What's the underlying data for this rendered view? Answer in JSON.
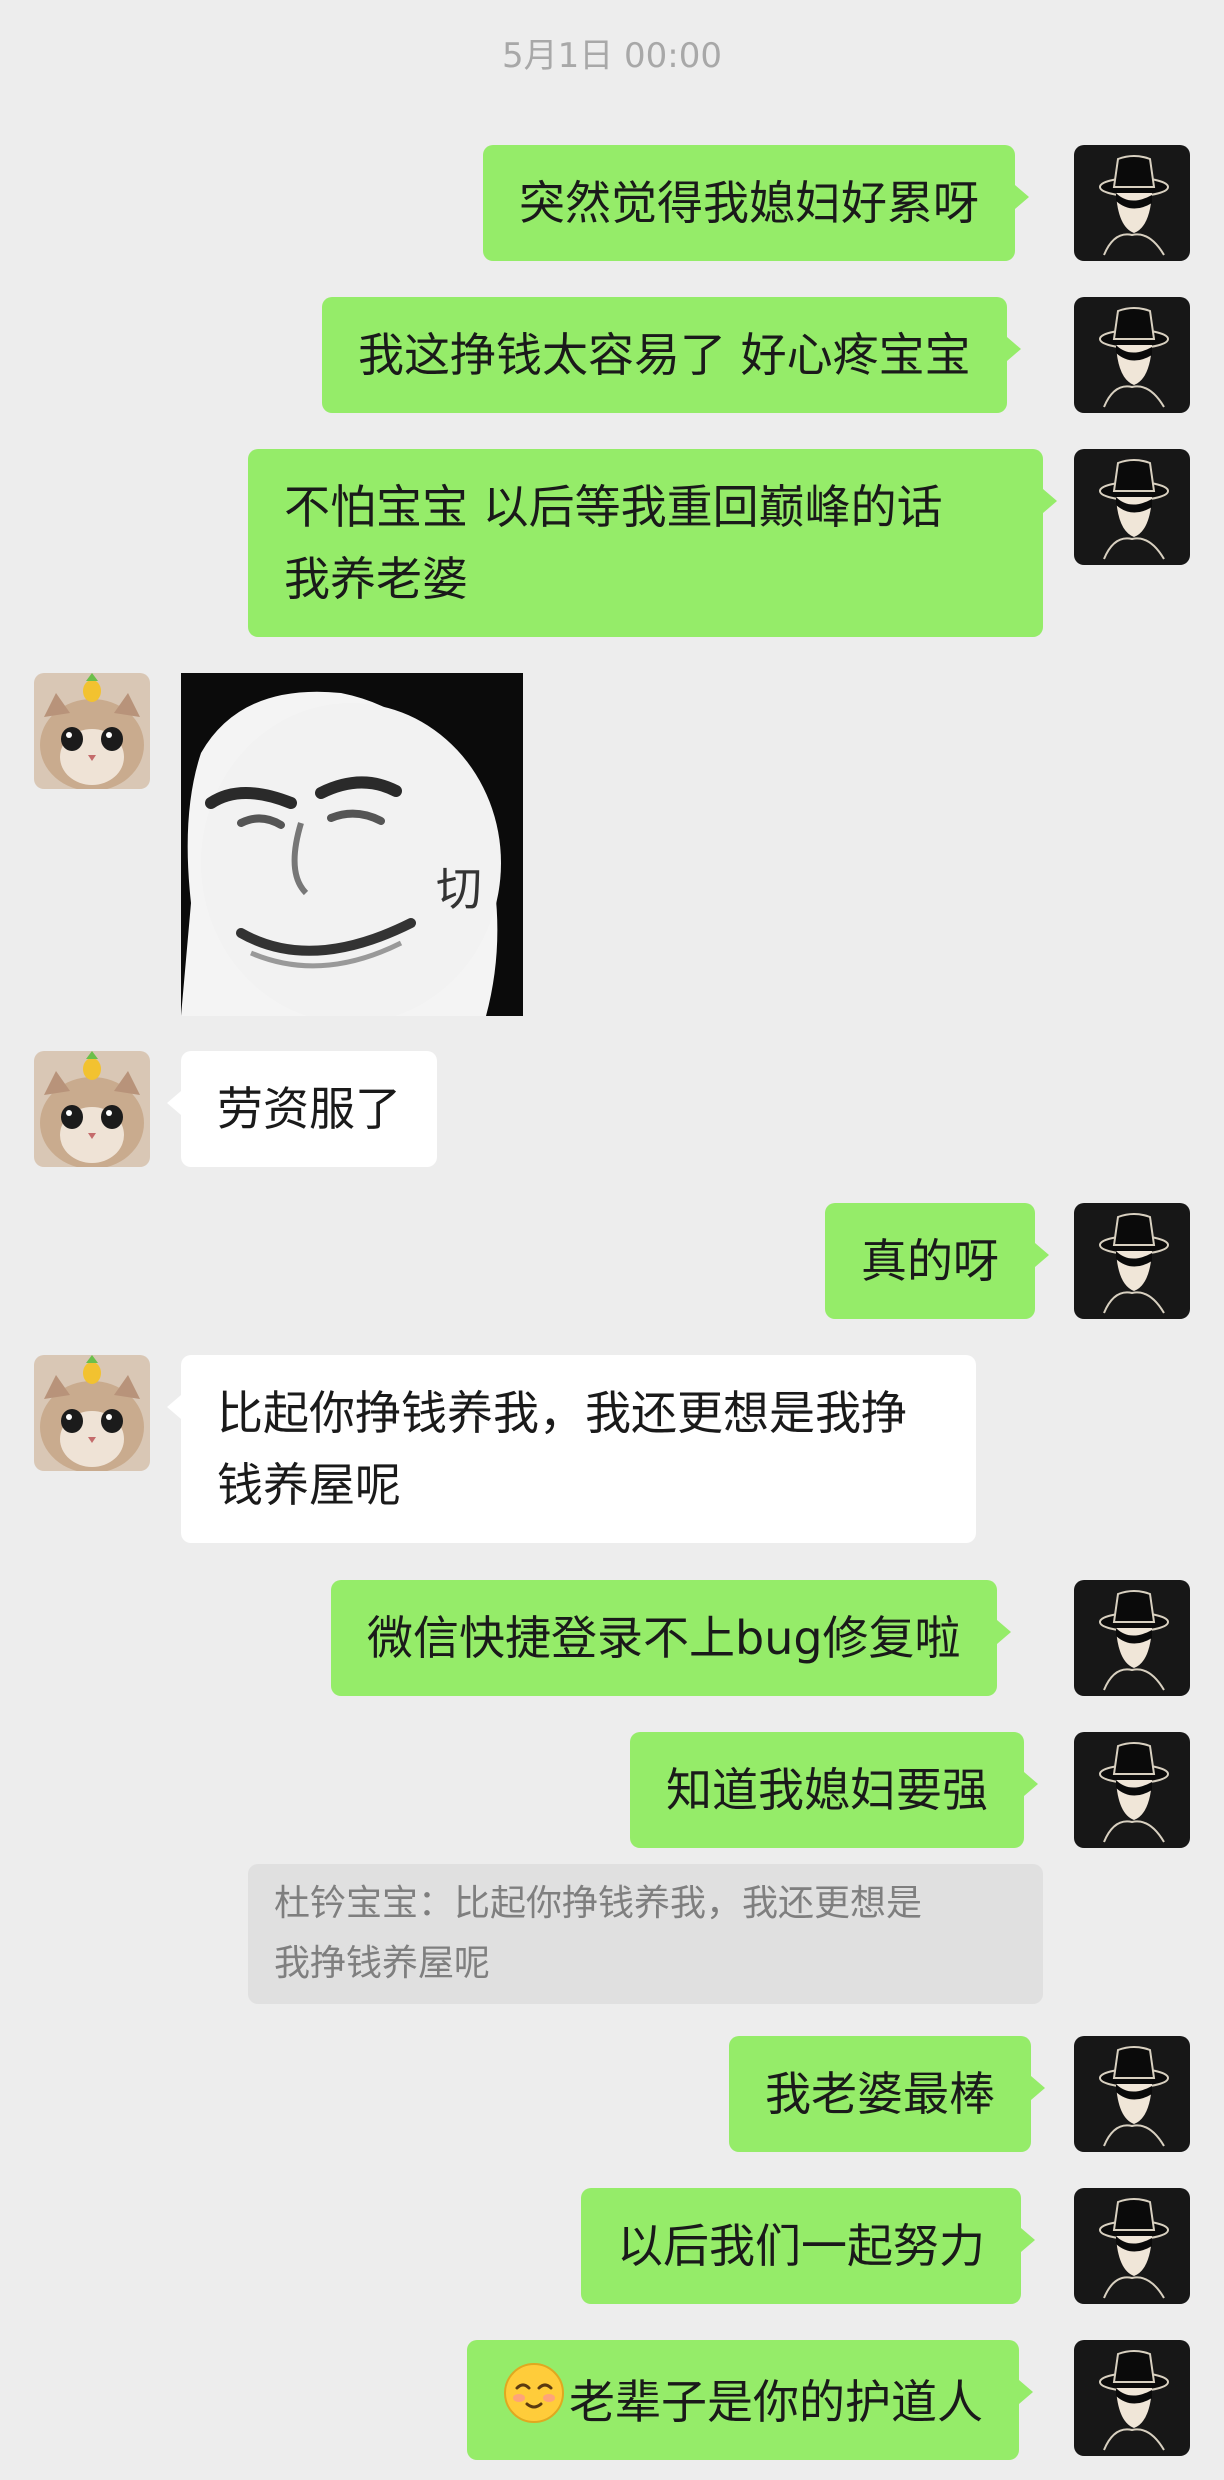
{
  "timestamp": "5月1日 00:00",
  "colors": {
    "background": "#ededed",
    "outgoing_bubble": "#95ec69",
    "incoming_bubble": "#ffffff",
    "quote_bg": "#e0e0e0"
  },
  "messages": [
    {
      "dir": "out",
      "lines": [
        "突然觉得我媳妇好累呀"
      ]
    },
    {
      "dir": "out",
      "lines": [
        "我这挣钱太容易了 好心疼宝宝"
      ]
    },
    {
      "dir": "out",
      "lines": [
        "不怕宝宝 以后等我重回巅峰的话",
        "我养老婆"
      ]
    },
    {
      "dir": "in",
      "type": "sticker",
      "caption": "切"
    },
    {
      "dir": "in",
      "lines": [
        "劳资服了"
      ]
    },
    {
      "dir": "out",
      "lines": [
        "真的呀"
      ]
    },
    {
      "dir": "in",
      "lines": [
        "比起你挣钱养我，我还更想是我挣",
        "钱养屋呢"
      ]
    },
    {
      "dir": "out",
      "lines": [
        "微信快捷登录不上bug修复啦"
      ]
    },
    {
      "dir": "out",
      "lines": [
        "知道我媳妇要强"
      ],
      "quote": [
        "杜钤宝宝：比起你挣钱养我，我还更想是",
        "我挣钱养屋呢"
      ]
    },
    {
      "dir": "out",
      "lines": [
        "我老婆最棒"
      ]
    },
    {
      "dir": "out",
      "lines": [
        "以后我们一起努力"
      ]
    },
    {
      "dir": "out",
      "lines": [
        "老辈子是你的护道人"
      ],
      "emoji": "smiling-face-emoji"
    }
  ],
  "avatars": {
    "self": "top-hat-man-avatar",
    "other": "cat-with-pineapple-avatar"
  }
}
